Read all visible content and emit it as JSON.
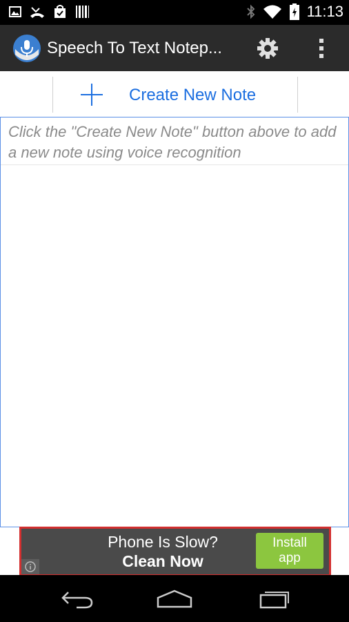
{
  "status_bar": {
    "time": "11:13",
    "left_icons": [
      "picture-icon",
      "missed-call-icon",
      "shopping-bag-icon",
      "barcode-icon"
    ],
    "right_icons": [
      "bluetooth-icon",
      "wifi-icon",
      "battery-charging-icon"
    ]
  },
  "action_bar": {
    "title": "Speech To Text Notep...",
    "icons": {
      "app": "microphone-app-icon",
      "settings": "gear-icon",
      "overflow": "overflow-menu-icon"
    }
  },
  "create_button": {
    "label": "Create New Note",
    "icon": "plus-icon",
    "color": "#1b6ee0"
  },
  "notes_list": {
    "empty_hint": "Click the \"Create New Note\" button above to add a new note using voice recognition"
  },
  "ad": {
    "headline_line1": "Phone Is Slow?",
    "headline_line2": "Clean Now",
    "cta_line1": "Install",
    "cta_line2": "app",
    "info_icon": "info-icon",
    "border_color": "#d32f2f",
    "cta_color": "#8cc63f"
  },
  "nav_bar": {
    "icons": [
      "back-icon",
      "home-icon",
      "recent-apps-icon"
    ]
  }
}
